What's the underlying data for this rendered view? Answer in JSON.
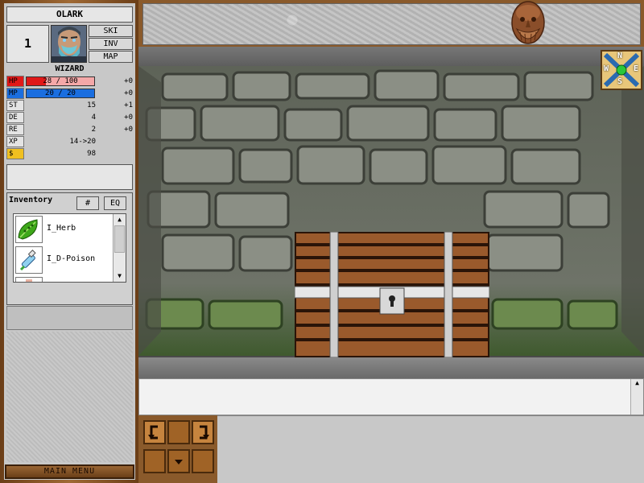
{
  "character": {
    "name": "OLARK",
    "level": "1",
    "class": "WIZARD",
    "portrait_icon": "bearded-man-portrait"
  },
  "side_buttons": [
    "SKI",
    "INV",
    "MAP"
  ],
  "stats": {
    "hp": {
      "key": "HP",
      "text": "28 / 100",
      "current": 28,
      "max": 100,
      "mod": "+0",
      "color": "#e01818"
    },
    "mp": {
      "key": "MP",
      "text": "20 / 20",
      "current": 20,
      "max": 20,
      "mod": "+0",
      "color": "#1a6ee0"
    },
    "st": {
      "key": "ST",
      "value": "15",
      "mod": "+1"
    },
    "de": {
      "key": "DE",
      "value": "4",
      "mod": "+0"
    },
    "re": {
      "key": "RE",
      "value": "2",
      "mod": "+0"
    },
    "xp": {
      "key": "XP",
      "value": "14->20"
    },
    "gold": {
      "key": "$",
      "value": "98",
      "color": "#f0c020"
    }
  },
  "inventory": {
    "title": "Inventory",
    "sort_button": "#",
    "equip_button": "EQ",
    "items": [
      {
        "name": "I_Herb",
        "icon": "green-leaf-icon"
      },
      {
        "name": "I_D-Poison",
        "icon": "potion-vial-icon"
      }
    ]
  },
  "main_menu_label": "MAIN MENU",
  "compass": {
    "n": "N",
    "e": "E",
    "s": "S",
    "w": "W"
  },
  "scene": {
    "object": "treasure-chest"
  }
}
